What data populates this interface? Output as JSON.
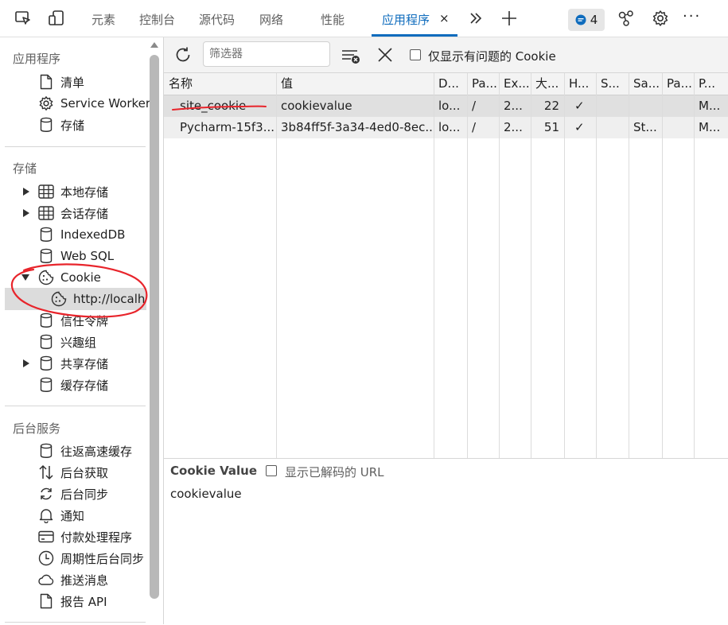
{
  "topbar": {
    "tabs": [
      {
        "label": "元素"
      },
      {
        "label": "控制台"
      },
      {
        "label": "源代码"
      },
      {
        "label": "网络"
      },
      {
        "label": "性能"
      },
      {
        "label": "应用程序"
      }
    ],
    "active_tab": "应用程序",
    "close_glyph": "×",
    "issues_count": "4",
    "more_glyph": "···",
    "icons": [
      "inspect-icon",
      "device-emulation-icon",
      "more-tabs-icon",
      "add-tool-icon",
      "issues-icon",
      "share-icon",
      "gear-icon",
      "more-icon"
    ]
  },
  "sidebar": {
    "section_app": {
      "title": "应用程序",
      "items": [
        {
          "label": "清单",
          "icon": "document-icon"
        },
        {
          "label": "Service Worker",
          "icon": "gear-icon"
        },
        {
          "label": "存储",
          "icon": "database-icon"
        }
      ]
    },
    "section_storage": {
      "title": "存储",
      "items": [
        {
          "label": "本地存储",
          "icon": "table-icon",
          "expandable": true
        },
        {
          "label": "会话存储",
          "icon": "table-icon",
          "expandable": true
        },
        {
          "label": "IndexedDB",
          "icon": "database-icon"
        },
        {
          "label": "Web SQL",
          "icon": "database-icon"
        },
        {
          "label": "Cookie",
          "icon": "cookie-icon",
          "expanded": true
        },
        {
          "label": "http://localh",
          "icon": "cookie-icon",
          "selected": true
        },
        {
          "label": "信任令牌",
          "icon": "database-icon"
        },
        {
          "label": "兴趣组",
          "icon": "database-icon"
        },
        {
          "label": "共享存储",
          "icon": "database-icon",
          "expandable": true
        },
        {
          "label": "缓存存储",
          "icon": "database-icon"
        }
      ]
    },
    "section_bg": {
      "title": "后台服务",
      "items": [
        {
          "label": "往返高速缓存",
          "icon": "database-icon"
        },
        {
          "label": "后台获取",
          "icon": "up-down-arrows-icon"
        },
        {
          "label": "后台同步",
          "icon": "sync-icon"
        },
        {
          "label": "通知",
          "icon": "bell-icon"
        },
        {
          "label": "付款处理程序",
          "icon": "credit-card-icon"
        },
        {
          "label": "周期性后台同步",
          "icon": "clock-icon"
        },
        {
          "label": "推送消息",
          "icon": "cloud-icon"
        },
        {
          "label": "报告 API",
          "icon": "document-icon"
        }
      ]
    }
  },
  "toolbar": {
    "filter_placeholder": "筛选器",
    "only_issues_label": "仅显示有问题的 Cookie",
    "only_issues_checked": false,
    "icons": [
      "refresh-icon",
      "clear-filter-icon",
      "clear-icon"
    ]
  },
  "table": {
    "columns": [
      "名称",
      "值",
      "D...",
      "Pa...",
      "Ex...",
      "大...",
      "H...",
      "S...",
      "Sa...",
      "Pa...",
      "P..."
    ],
    "rows": [
      [
        "site_cookie",
        "cookievalue",
        "lo...",
        "/",
        "2...",
        "22",
        "✓",
        "",
        "",
        "",
        "M..."
      ],
      [
        "Pycharm-15f3...",
        "3b84ff5f-3a34-4ed0-8ec...",
        "lo...",
        "/",
        "2...",
        "51",
        "✓",
        "",
        "St...",
        "",
        "M..."
      ]
    ],
    "selected_row": 0
  },
  "details": {
    "title": "Cookie Value",
    "show_decoded_label": "显示已解码的 URL",
    "show_decoded_checked": false,
    "value": "cookievalue"
  },
  "colors": {
    "accent": "#0f6cbd",
    "annotation": "#e8242b"
  }
}
